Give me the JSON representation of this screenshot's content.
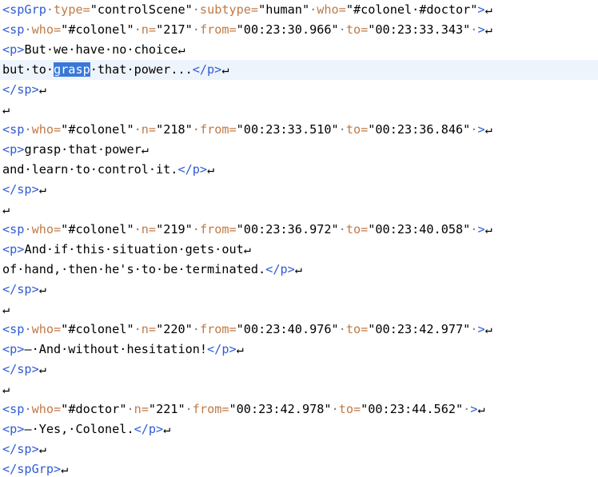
{
  "colors": {
    "tag": "#2f5bd6",
    "attribute": "#c07a45",
    "text": "#000000",
    "whitespace_marker": "#7a7a7a",
    "selection": "#3a78d8",
    "current_line": "#eef4fb"
  },
  "selected_word": "grasp",
  "current_line": 3,
  "lines": [
    [
      [
        "b",
        "<spGrp"
      ],
      [
        "d",
        "·"
      ],
      [
        "o",
        "type="
      ],
      [
        "k",
        "\"controlScene\""
      ],
      [
        "d",
        "·"
      ],
      [
        "o",
        "subtype="
      ],
      [
        "k",
        "\"human\""
      ],
      [
        "d",
        "·"
      ],
      [
        "o",
        "who="
      ],
      [
        "k",
        "\"#colonel·#doctor\""
      ],
      [
        "b",
        ">"
      ],
      [
        "k",
        "↵"
      ]
    ],
    [
      [
        "b",
        "<sp"
      ],
      [
        "d",
        "·"
      ],
      [
        "o",
        "who="
      ],
      [
        "k",
        "\"#colonel\""
      ],
      [
        "d",
        "·"
      ],
      [
        "o",
        "n="
      ],
      [
        "k",
        "\"217\""
      ],
      [
        "d",
        "·"
      ],
      [
        "o",
        "from="
      ],
      [
        "k",
        "\"00:23:30.966\""
      ],
      [
        "d",
        "·"
      ],
      [
        "o",
        "to="
      ],
      [
        "k",
        "\"00:23:33.343\""
      ],
      [
        "d",
        "·"
      ],
      [
        "b",
        ">"
      ],
      [
        "k",
        "↵"
      ]
    ],
    [
      [
        "b",
        "<p>"
      ],
      [
        "k",
        "But·we·have·no·choice↵"
      ]
    ],
    [
      [
        "k",
        "but·to·"
      ],
      [
        "s",
        "grasp"
      ],
      [
        "k",
        "·that·power..."
      ],
      [
        "b",
        "</p>"
      ],
      [
        "k",
        "↵"
      ]
    ],
    [
      [
        "b",
        "</sp>"
      ],
      [
        "k",
        "↵"
      ]
    ],
    [
      [
        "k",
        "↵"
      ]
    ],
    [
      [
        "b",
        "<sp"
      ],
      [
        "d",
        "·"
      ],
      [
        "o",
        "who="
      ],
      [
        "k",
        "\"#colonel\""
      ],
      [
        "d",
        "·"
      ],
      [
        "o",
        "n="
      ],
      [
        "k",
        "\"218\""
      ],
      [
        "d",
        "·"
      ],
      [
        "o",
        "from="
      ],
      [
        "k",
        "\"00:23:33.510\""
      ],
      [
        "d",
        "·"
      ],
      [
        "o",
        "to="
      ],
      [
        "k",
        "\"00:23:36.846\""
      ],
      [
        "d",
        "·"
      ],
      [
        "b",
        ">"
      ],
      [
        "k",
        "↵"
      ]
    ],
    [
      [
        "b",
        "<p>"
      ],
      [
        "k",
        "grasp·that·power↵"
      ]
    ],
    [
      [
        "k",
        "and·learn·to·control·it."
      ],
      [
        "b",
        "</p>"
      ],
      [
        "k",
        "↵"
      ]
    ],
    [
      [
        "b",
        "</sp>"
      ],
      [
        "k",
        "↵"
      ]
    ],
    [
      [
        "k",
        "↵"
      ]
    ],
    [
      [
        "b",
        "<sp"
      ],
      [
        "d",
        "·"
      ],
      [
        "o",
        "who="
      ],
      [
        "k",
        "\"#colonel\""
      ],
      [
        "d",
        "·"
      ],
      [
        "o",
        "n="
      ],
      [
        "k",
        "\"219\""
      ],
      [
        "d",
        "·"
      ],
      [
        "o",
        "from="
      ],
      [
        "k",
        "\"00:23:36.972\""
      ],
      [
        "d",
        "·"
      ],
      [
        "o",
        "to="
      ],
      [
        "k",
        "\"00:23:40.058\""
      ],
      [
        "d",
        "·"
      ],
      [
        "b",
        ">"
      ],
      [
        "k",
        "↵"
      ]
    ],
    [
      [
        "b",
        "<p>"
      ],
      [
        "k",
        "And·if·this·situation·gets·out↵"
      ]
    ],
    [
      [
        "k",
        "of·hand,·then·he's·to·be·terminated."
      ],
      [
        "b",
        "</p>"
      ],
      [
        "k",
        "↵"
      ]
    ],
    [
      [
        "b",
        "</sp>"
      ],
      [
        "k",
        "↵"
      ]
    ],
    [
      [
        "k",
        "↵"
      ]
    ],
    [
      [
        "b",
        "<sp"
      ],
      [
        "d",
        "·"
      ],
      [
        "o",
        "who="
      ],
      [
        "k",
        "\"#colonel\""
      ],
      [
        "d",
        "·"
      ],
      [
        "o",
        "n="
      ],
      [
        "k",
        "\"220\""
      ],
      [
        "d",
        "·"
      ],
      [
        "o",
        "from="
      ],
      [
        "k",
        "\"00:23:40.976\""
      ],
      [
        "d",
        "·"
      ],
      [
        "o",
        "to="
      ],
      [
        "k",
        "\"00:23:42.977\""
      ],
      [
        "d",
        "·"
      ],
      [
        "b",
        ">"
      ],
      [
        "k",
        "↵"
      ]
    ],
    [
      [
        "b",
        "<p>"
      ],
      [
        "k",
        "–·And·without·hesitation!"
      ],
      [
        "b",
        "</p>"
      ],
      [
        "k",
        "↵"
      ]
    ],
    [
      [
        "b",
        "</sp>"
      ],
      [
        "k",
        "↵"
      ]
    ],
    [
      [
        "k",
        "↵"
      ]
    ],
    [
      [
        "b",
        "<sp"
      ],
      [
        "d",
        "·"
      ],
      [
        "o",
        "who="
      ],
      [
        "k",
        "\"#doctor\""
      ],
      [
        "d",
        "·"
      ],
      [
        "o",
        "n="
      ],
      [
        "k",
        "\"221\""
      ],
      [
        "d",
        "·"
      ],
      [
        "o",
        "from="
      ],
      [
        "k",
        "\"00:23:42.978\""
      ],
      [
        "d",
        "·"
      ],
      [
        "o",
        "to="
      ],
      [
        "k",
        "\"00:23:44.562\""
      ],
      [
        "d",
        "·"
      ],
      [
        "b",
        ">"
      ],
      [
        "k",
        "↵"
      ]
    ],
    [
      [
        "b",
        "<p>"
      ],
      [
        "k",
        "–·Yes,·Colonel."
      ],
      [
        "b",
        "</p>"
      ],
      [
        "k",
        "↵"
      ]
    ],
    [
      [
        "b",
        "</sp>"
      ],
      [
        "k",
        "↵"
      ]
    ],
    [
      [
        "b",
        "</spGrp>"
      ],
      [
        "k",
        "↵"
      ]
    ]
  ]
}
